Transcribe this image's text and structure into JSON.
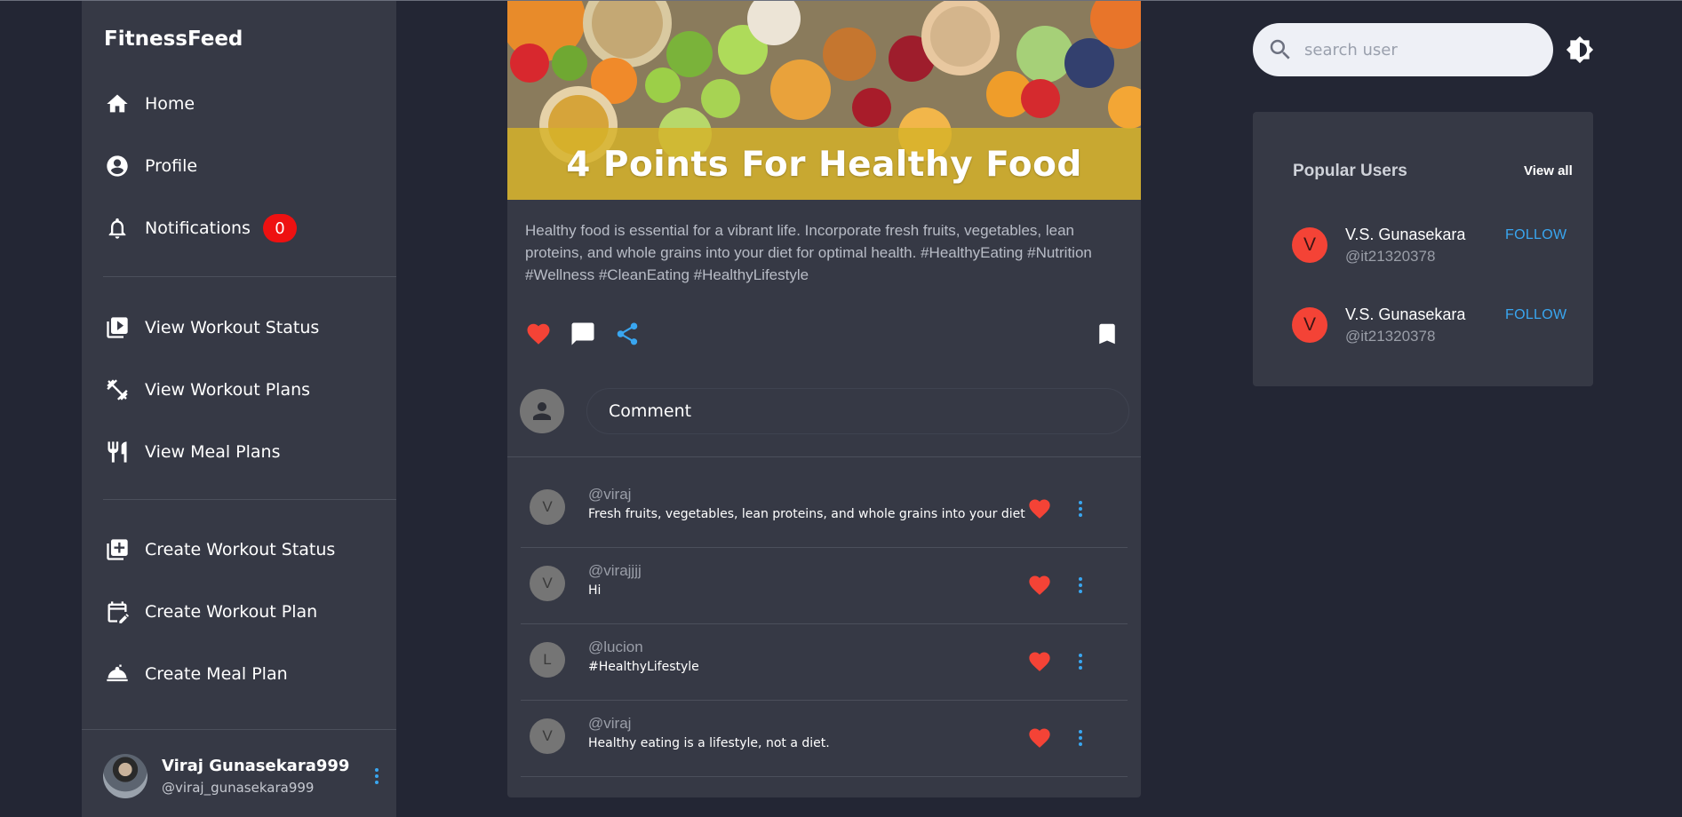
{
  "app": {
    "brand": "FitnessFeed"
  },
  "sidebar": {
    "items": [
      {
        "label": "Home",
        "icon": "home-icon"
      },
      {
        "label": "Profile",
        "icon": "account-circle-icon"
      },
      {
        "label": "Notifications",
        "icon": "bell-icon",
        "badge": "0"
      },
      {
        "label": "View Workout Status",
        "icon": "video-library-icon"
      },
      {
        "label": "View Workout Plans",
        "icon": "dumbbell-icon"
      },
      {
        "label": "View Meal Plans",
        "icon": "restaurant-icon"
      },
      {
        "label": "Create Workout Status",
        "icon": "library-add-icon"
      },
      {
        "label": "Create Workout Plan",
        "icon": "edit-calendar-icon"
      },
      {
        "label": "Create Meal Plan",
        "icon": "room-service-icon"
      }
    ],
    "user": {
      "name": "Viraj Gunasekara999",
      "handle": "@viraj_gunasekara999"
    }
  },
  "post": {
    "image_title": "4 Points For Healthy Food",
    "caption": "Healthy food is essential for a vibrant life. Incorporate fresh fruits, vegetables, lean proteins, and whole grains into your diet for optimal health. #HealthyEating #Nutrition #Wellness #CleanEating #HealthyLifestyle",
    "comment_input": {
      "value": "Comment",
      "placeholder": "Comment"
    },
    "comments": [
      {
        "initial": "V",
        "user": "@viraj",
        "text": "Fresh fruits, vegetables, lean proteins, and whole grains into your diet"
      },
      {
        "initial": "V",
        "user": "@virajjjj",
        "text": "Hi"
      },
      {
        "initial": "L",
        "user": "@lucion",
        "text": "#HealthyLifestyle"
      },
      {
        "initial": "V",
        "user": "@viraj",
        "text": "Healthy eating is a lifestyle, not a diet."
      }
    ]
  },
  "search": {
    "placeholder": "search user"
  },
  "popular": {
    "title": "Popular Users",
    "view_all": "View all",
    "users": [
      {
        "initial": "V",
        "name": "V.S. Gunasekara",
        "handle": "@it21320378",
        "follow": "FOLLOW"
      },
      {
        "initial": "V",
        "name": "V.S. Gunasekara",
        "handle": "@it21320378",
        "follow": "FOLLOW"
      }
    ]
  },
  "colors": {
    "background": "#232634",
    "panel": "#363945",
    "accent_blue": "#39a6f0",
    "like_red": "#f44336",
    "badge_red": "#ee1111",
    "banner_yellow": "#d6b228"
  }
}
